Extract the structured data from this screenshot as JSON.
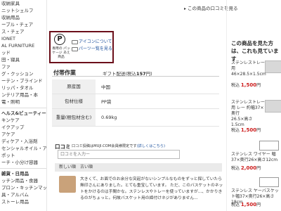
{
  "sidebar": {
    "items_top": [
      "収納家具",
      "ニットシェルフ",
      "収納用品",
      "ーブル・チェア",
      "ス・チェア",
      "IONET",
      "AL FURNITURE",
      "ッド",
      "田・寝具",
      "ファ",
      "グ・クッション",
      "ーテン・ブラインド",
      "リッパ・タオル",
      "ンテリア用品・本",
      "電・照明"
    ],
    "head1": "ヘルス&ビューティー",
    "items_health": [
      "キンケア",
      "イクアップ",
      "アケア",
      "ディケア・入浴剤",
      "センシャルオイル・アロマ",
      "ポット",
      "ーチ・小分け容器"
    ],
    "head2": "雑貨・日用品",
    "items_goods": [
      "ッチン用品・食器",
      "プロン・キッチンマット",
      "具・アルバム",
      "ストーレ用品"
    ]
  },
  "toplink": "この商品の口コミを見る",
  "icons": {
    "p_symbol": "P",
    "caption": "専用の パッケージ あえ商品",
    "link1": "アイコンについて",
    "link2": "パーツ一覧を見る"
  },
  "gift": {
    "title": "付帯作業",
    "prefix": "ギフト配送(税込",
    "price": "157",
    "suffix": "円)"
  },
  "specs": [
    {
      "key": "原産国",
      "value": "中国"
    },
    {
      "key": "包材仕様",
      "value": "PP袋"
    },
    {
      "key": "重量(梱包材含む)",
      "value": "0.69kg"
    }
  ],
  "reviews": {
    "title": "口コミ",
    "note": "口コミ投稿はMUJI.COM会員様限定です",
    "note_link": "(詳しくはこちら)",
    "input_placeholder": "口コミを入力ー",
    "bar_label": "新しい順　古い順",
    "text": "大きくて、お面でのお余分な突起がないシンプルなものをずっと探していたら無印さんにありました。とても重宝しています。 ただ、このバスケットのネットをかけるのは手間かな。ステンレスやトレーを使っていますが...、かかりきるのがちょっと。何故バスケット用の締付けネジがありません..."
  },
  "right": {
    "title": "この商品を見た方は、これも見ています",
    "products": [
      {
        "name": "ステンレストレー用",
        "size": "46×28.5×1.5cm",
        "price": "1,500",
        "unit": "円"
      },
      {
        "name": "ステンレストレー用 レー 約幅37×奥行",
        "size": "26.5×高さ1.5cm",
        "price": "1,500",
        "unit": "円"
      },
      {
        "name": "ステンレス ワイヤー 幅37×奥行26×高さ12cm",
        "size": "",
        "price": "2,000",
        "unit": "円"
      },
      {
        "name": "ステンレス ヤーバスケット幅37×奥行26×高さ18cm",
        "size": "",
        "price": "1,500",
        "unit": "円"
      }
    ]
  }
}
